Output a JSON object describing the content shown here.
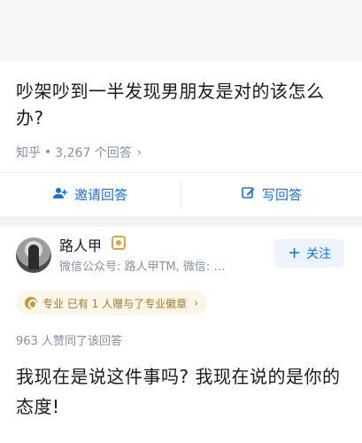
{
  "question": {
    "title": "吵架吵到一半发现男朋友是对的该怎么办?",
    "source": "知乎",
    "dot": "•",
    "answer_count": "3,267 个回答",
    "chevron": "›"
  },
  "actions": {
    "invite_label": "邀请回答",
    "write_label": "写回答",
    "invite_icon": "add-user-icon",
    "write_icon": "edit-icon"
  },
  "answer": {
    "author_name": "路人甲",
    "author_bio": "微信公众号: 路人甲TM, 微信: …",
    "follow_label": "关注",
    "follow_plus": "+",
    "pro_text": "专业 已有 1 人赠与了专业徽章",
    "pro_chevron": "›",
    "votes_text": "963 人赞同了该回答",
    "content": "我现在是说这件事吗? 我现在说的是你的态度!"
  },
  "colors": {
    "accent": "#1772e6",
    "meta": "#8590a6",
    "gold": "#c89a3c"
  }
}
